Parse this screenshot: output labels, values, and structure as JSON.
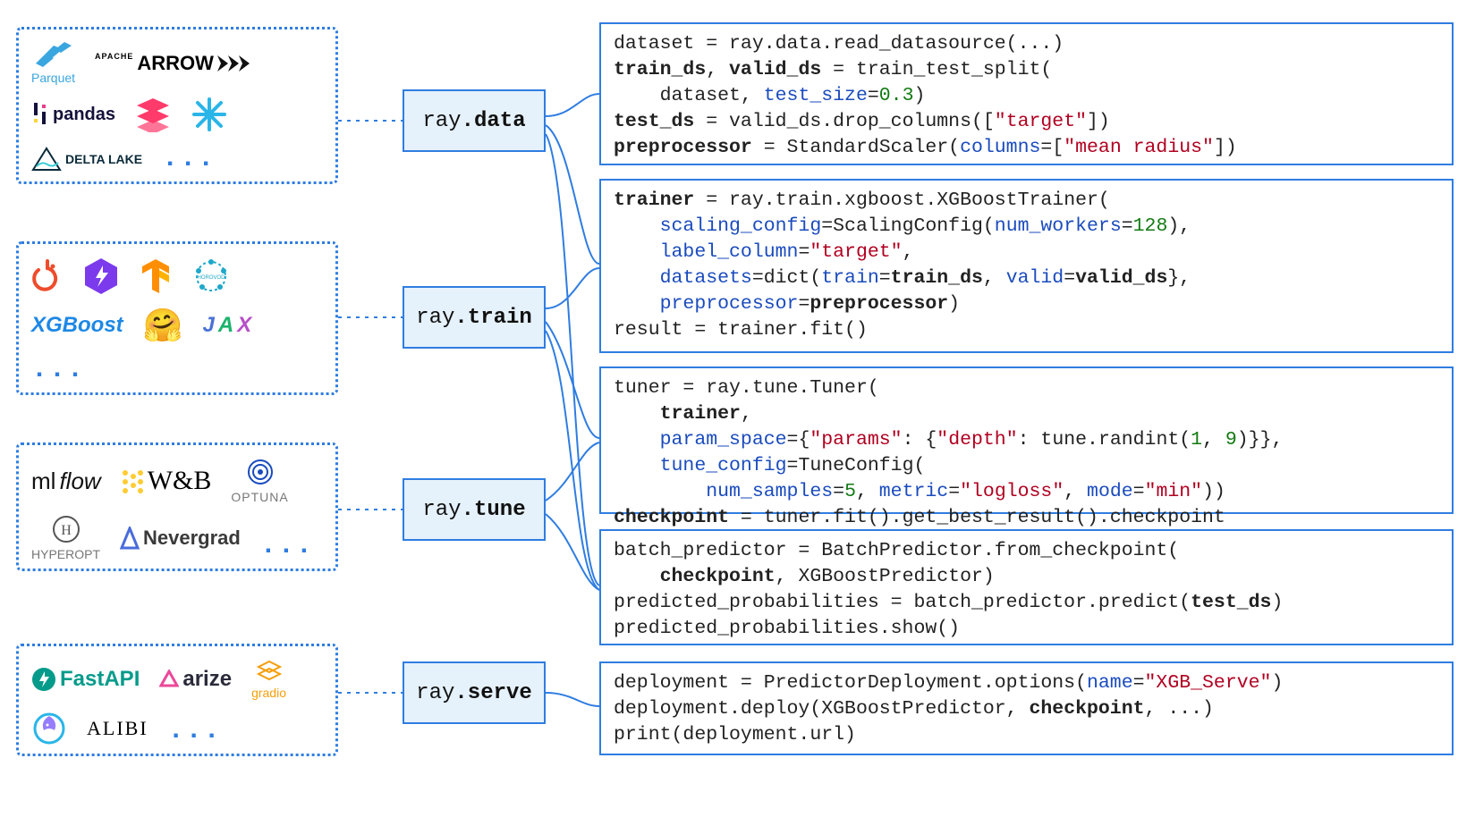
{
  "ecosystems": {
    "data": {
      "logos": [
        "Parquet",
        "Apache Arrow",
        "pandas",
        "Databricks",
        "Snowflake",
        "Delta Lake"
      ],
      "more": "..."
    },
    "train": {
      "logos": [
        "PyTorch",
        "Lightning",
        "TensorFlow",
        "Horovod",
        "XGBoost",
        "Hugging Face",
        "JAX"
      ],
      "more": "..."
    },
    "tune": {
      "logos": [
        "mlflow",
        "W&B",
        "Optuna",
        "Hyperopt",
        "Nevergrad"
      ],
      "more": "..."
    },
    "serve": {
      "logos": [
        "FastAPI",
        "arize",
        "gradio",
        "Seldon",
        "ALIBI"
      ],
      "more": "..."
    }
  },
  "modules": {
    "data": {
      "prefix": "ray",
      "suffix": ".data"
    },
    "train": {
      "prefix": "ray",
      "suffix": ".train"
    },
    "tune": {
      "prefix": "ray",
      "suffix": ".tune"
    },
    "serve": {
      "prefix": "ray",
      "suffix": ".serve"
    }
  },
  "code": {
    "data": {
      "l1a": "dataset = ray.data.read_datasource(...)",
      "l2a": "train_ds",
      "l2b": ", ",
      "l2c": "valid_ds",
      "l2d": " = train_test_split(",
      "l3a": "    dataset, ",
      "l3b": "test_size",
      "l3c": "=",
      "l3d": "0.3",
      "l3e": ")",
      "l4a": "test_ds",
      "l4b": " = valid_ds.drop_columns([",
      "l4c": "\"target\"",
      "l4d": "])",
      "l5a": "preprocessor",
      "l5b": " = StandardScaler(",
      "l5c": "columns",
      "l5d": "=[",
      "l5e": "\"mean radius\"",
      "l5f": "])"
    },
    "train": {
      "l1a": "trainer",
      "l1b": " = ray.train.xgboost.XGBoostTrainer(",
      "l2a": "    ",
      "l2b": "scaling_config",
      "l2c": "=ScalingConfig(",
      "l2d": "num_workers",
      "l2e": "=",
      "l2f": "128",
      "l2g": "),",
      "l3a": "    ",
      "l3b": "label_column",
      "l3c": "=",
      "l3d": "\"target\"",
      "l3e": ",",
      "l4a": "    ",
      "l4b": "datasets",
      "l4c": "=dict(",
      "l4d": "train",
      "l4e": "=",
      "l4f": "train_ds",
      "l4g": ", ",
      "l4h": "valid",
      "l4i": "=",
      "l4j": "valid_ds",
      "l4k": "},",
      "l5a": "    ",
      "l5b": "preprocessor",
      "l5c": "=",
      "l5d": "preprocessor",
      "l5e": ")",
      "l6a": "result = trainer.fit()"
    },
    "tune": {
      "l1a": "tuner = ray.tune.Tuner(",
      "l2a": "    ",
      "l2b": "trainer",
      "l2c": ",",
      "l3a": "    ",
      "l3b": "param_space",
      "l3c": "={",
      "l3d": "\"params\"",
      "l3e": ": {",
      "l3f": "\"depth\"",
      "l3g": ": tune.randint(",
      "l3h": "1",
      "l3i": ", ",
      "l3j": "9",
      "l3k": ")}},",
      "l4a": "    ",
      "l4b": "tune_config",
      "l4c": "=TuneConfig(",
      "l5a": "        ",
      "l5b": "num_samples",
      "l5c": "=",
      "l5d": "5",
      "l5e": ", ",
      "l5f": "metric",
      "l5g": "=",
      "l5h": "\"logloss\"",
      "l5i": ", ",
      "l5j": "mode",
      "l5k": "=",
      "l5l": "\"min\"",
      "l5m": "))",
      "l6a": "checkpoint",
      "l6b": " = tuner.fit().get_best_result().checkpoint"
    },
    "predict": {
      "l1a": "batch_predictor = BatchPredictor.from_checkpoint(",
      "l2a": "    ",
      "l2b": "checkpoint",
      "l2c": ", XGBoostPredictor)",
      "l3a": "predicted_probabilities = batch_predictor.predict(",
      "l3b": "test_ds",
      "l3c": ")",
      "l4a": "predicted_probabilities.show()"
    },
    "serve": {
      "l1a": "deployment = PredictorDeployment.options(",
      "l1b": "name",
      "l1c": "=",
      "l1d": "\"XGB_Serve\"",
      "l1e": ")",
      "l2a": "deployment.deploy(XGBoostPredictor, ",
      "l2b": "checkpoint",
      "l2c": ", ...)",
      "l3a": "print(deployment.url)"
    }
  }
}
